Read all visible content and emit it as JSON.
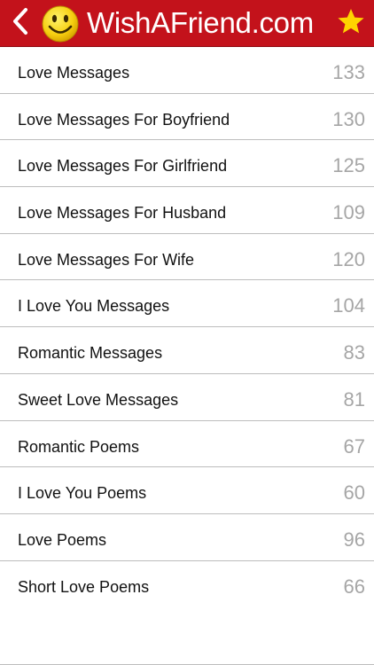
{
  "header": {
    "brand": "WishAFriend.com",
    "back_icon": "chevron-left-icon",
    "logo_icon": "smiley-face-icon",
    "favorite_icon": "star-icon",
    "colors": {
      "bar": "#c3121b",
      "icon": "#ffffff",
      "star": "#ffd400"
    }
  },
  "categories": [
    {
      "label": "Love Messages",
      "count": "133"
    },
    {
      "label": "Love Messages For Boyfriend",
      "count": "130"
    },
    {
      "label": "Love Messages For Girlfriend",
      "count": "125"
    },
    {
      "label": "Love Messages For Husband",
      "count": "109"
    },
    {
      "label": "Love Messages For Wife",
      "count": "120"
    },
    {
      "label": "I Love You Messages",
      "count": "104"
    },
    {
      "label": "Romantic Messages",
      "count": "83"
    },
    {
      "label": "Sweet Love Messages",
      "count": "81"
    },
    {
      "label": "Romantic Poems",
      "count": "67"
    },
    {
      "label": "I Love You Poems",
      "count": "60"
    },
    {
      "label": "Love Poems",
      "count": "96"
    },
    {
      "label": "Short Love Poems",
      "count": "66"
    }
  ]
}
